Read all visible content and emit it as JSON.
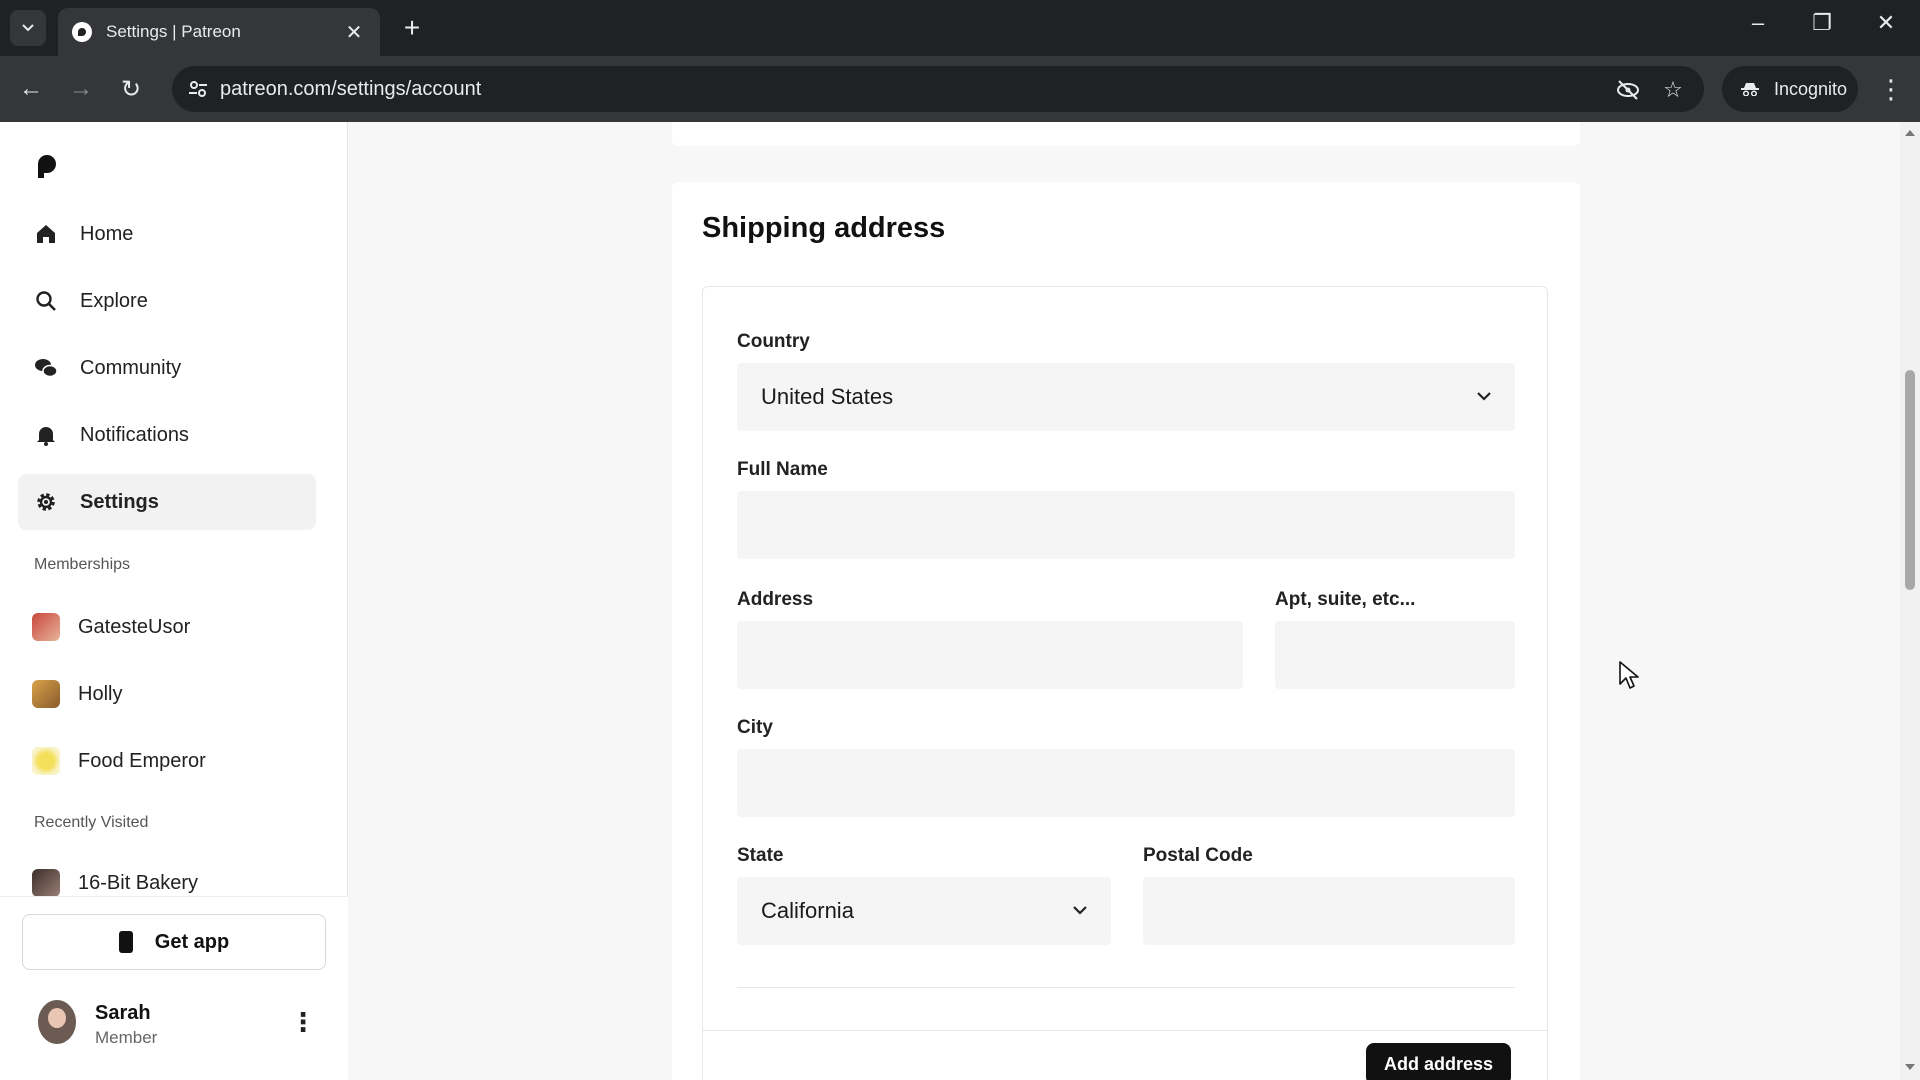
{
  "browser": {
    "tab_title": "Settings | Patreon",
    "url": "patreon.com/settings/account",
    "incognito_label": "Incognito"
  },
  "sidebar": {
    "nav": [
      {
        "label": "Home",
        "icon": "home-icon"
      },
      {
        "label": "Explore",
        "icon": "search-icon"
      },
      {
        "label": "Community",
        "icon": "chat-icon"
      },
      {
        "label": "Notifications",
        "icon": "bell-icon"
      },
      {
        "label": "Settings",
        "icon": "gear-icon",
        "active": true
      }
    ],
    "memberships_label": "Memberships",
    "memberships": [
      {
        "label": "GatesteUsor"
      },
      {
        "label": "Holly"
      },
      {
        "label": "Food Emperor"
      }
    ],
    "recent_label": "Recently Visited",
    "recent": [
      {
        "label": "16-Bit Bakery"
      }
    ],
    "get_app_label": "Get app",
    "user": {
      "name": "Sarah",
      "role": "Member"
    }
  },
  "shipping": {
    "title": "Shipping address",
    "country_label": "Country",
    "country_value": "United States",
    "fullname_label": "Full Name",
    "fullname_value": "",
    "address_label": "Address",
    "address_value": "",
    "apt_label": "Apt, suite, etc...",
    "apt_value": "",
    "city_label": "City",
    "city_value": "",
    "state_label": "State",
    "state_value": "California",
    "postal_label": "Postal Code",
    "postal_value": "",
    "submit_label": "Add address"
  }
}
